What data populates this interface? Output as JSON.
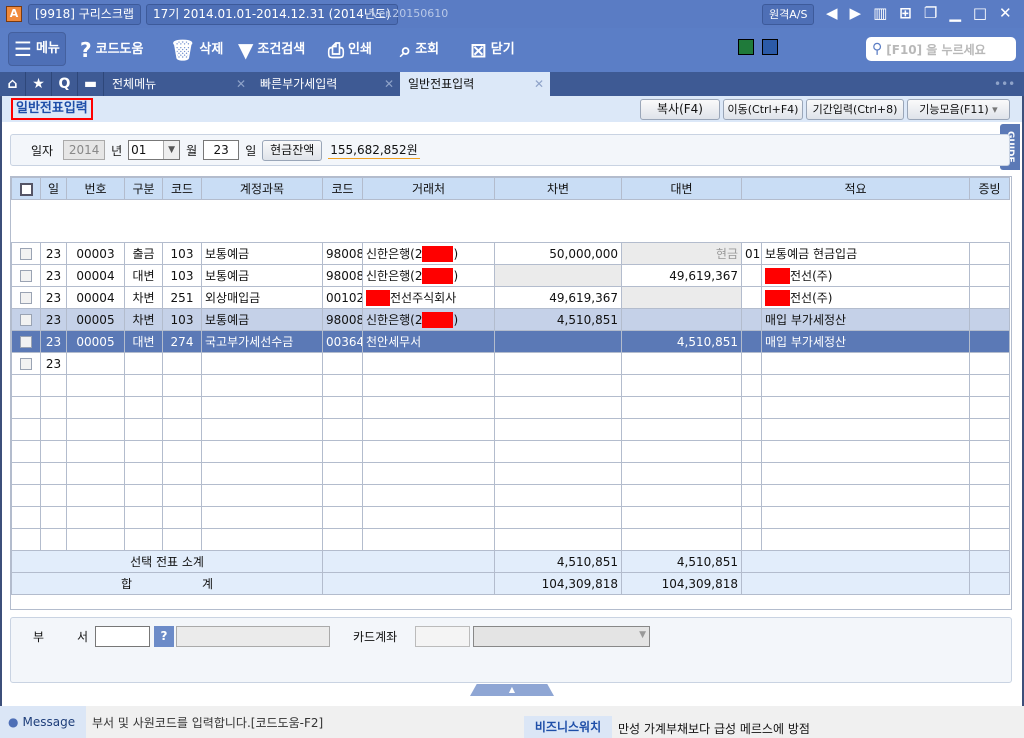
{
  "titlebar": {
    "company": "[9918] 구리스크랩",
    "period": "17기 2014.01.01-2014.12.31 (2014년도)",
    "version": "ver.20150610",
    "remote": "원격A/S"
  },
  "toolbar": {
    "menu": "메뉴",
    "help": "코드도움",
    "delete": "삭제",
    "filter": "조건검색",
    "print": "인쇄",
    "view": "조회",
    "close": "닫기",
    "search_placeholder": "[F10] 을 누르세요"
  },
  "tabs": [
    {
      "label": "전체메뉴"
    },
    {
      "label": "빠른부가세입력"
    },
    {
      "label": "일반전표입력"
    }
  ],
  "page": {
    "title": "일반전표입력",
    "buttons": {
      "copy": "복사(F4)",
      "move": "이동(Ctrl+F4)",
      "period": "기간입력(Ctrl+8)",
      "functions": "기능모음(F11)"
    },
    "guide": "GUIDE"
  },
  "datebar": {
    "date_label": "일자",
    "year": "2014",
    "year_unit": "년",
    "month": "01",
    "month_unit": "월",
    "day": "23",
    "day_unit": "일",
    "cash_button": "현금잔액",
    "cash_balance": "155,682,852원"
  },
  "grid": {
    "headers": [
      "일",
      "번호",
      "구분",
      "코드",
      "계정과목",
      "코드",
      "거래처",
      "차변",
      "대변",
      "적요",
      "증빙"
    ],
    "rows": [
      {
        "day": "23",
        "no": "00003",
        "type": "출금",
        "code": "103",
        "account": "보통예금",
        "pcode": "98008",
        "partner": "신한은행(2",
        "partner_end": ")",
        "debit": "50,000,000",
        "credit": "현금",
        "memo_code": "01",
        "memo": "보통예금 현금입금"
      },
      {
        "day": "23",
        "no": "00004",
        "type": "대변",
        "code": "103",
        "account": "보통예금",
        "pcode": "98008",
        "partner": "신한은행(2",
        "partner_end": ")",
        "debit": "",
        "credit": "49,619,367",
        "memo_code": "",
        "memo": "전선(주)"
      },
      {
        "day": "23",
        "no": "00004",
        "type": "차변",
        "code": "251",
        "account": "외상매입금",
        "pcode": "00102",
        "partner": "전선주식회사",
        "partner_end": "",
        "debit": "49,619,367",
        "credit": "",
        "memo_code": "",
        "memo": "전선(주)"
      },
      {
        "day": "23",
        "no": "00005",
        "type": "차변",
        "code": "103",
        "account": "보통예금",
        "pcode": "98008",
        "partner": "신한은행(2",
        "partner_end": ")",
        "debit": "4,510,851",
        "credit": "",
        "memo_code": "",
        "memo": "매입 부가세정산"
      },
      {
        "day": "23",
        "no": "00005",
        "type": "대변",
        "code": "274",
        "account": "국고부가세선수금",
        "pcode": "00364",
        "partner": "천안세무서",
        "partner_end": "",
        "debit": "",
        "credit": "4,510,851",
        "memo_code": "",
        "memo": "매입 부가세정산"
      }
    ],
    "new_row_day": "23",
    "subtotal": {
      "label": "선택 전표 소계",
      "debit": "4,510,851",
      "credit": "4,510,851"
    },
    "total": {
      "label1": "합",
      "label2": "계",
      "debit": "104,309,818",
      "credit": "104,309,818"
    }
  },
  "bottom": {
    "dept_label1": "부",
    "dept_label2": "서",
    "card_label": "카드계좌"
  },
  "status": {
    "message_label": "Message",
    "message": "부서 및 사원코드를 입력합니다.[코드도움-F2]",
    "news_label": "비즈니스워치",
    "news": "만성 가계부채보다 급성 메르스에 방점"
  }
}
